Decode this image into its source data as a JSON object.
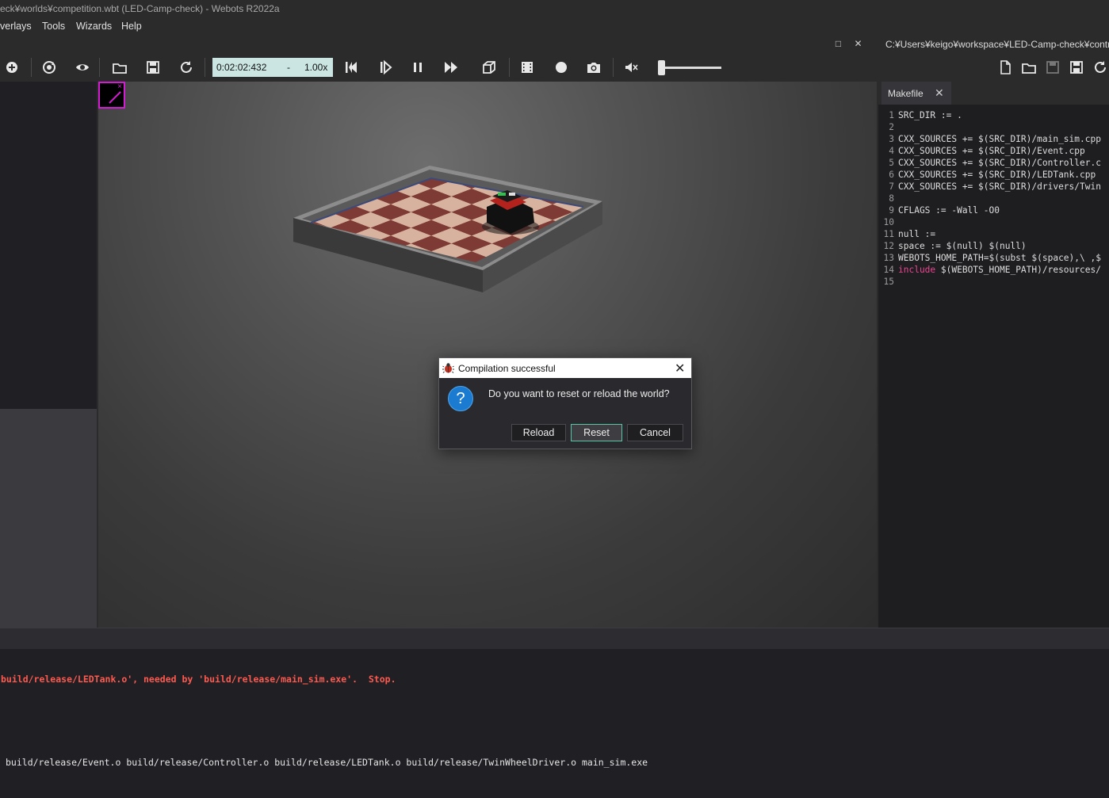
{
  "window": {
    "title": "eck¥worlds¥competition.wbt (LED-Camp-check) - Webots R2022a"
  },
  "menu": {
    "items": [
      {
        "label": "verlays"
      },
      {
        "label": "Tools"
      },
      {
        "label": "Wizards"
      },
      {
        "label": "Help"
      }
    ]
  },
  "panelbar": {
    "restore_symbol": "□",
    "close_symbol": "✕",
    "editor_path": "C:¥Users¥keigo¥workspace¥LED-Camp-check¥controll"
  },
  "toolbar": {
    "icons": [
      "add-node-icon",
      "reset-view-icon",
      "view-icon",
      "open-world-icon",
      "save-world-icon",
      "reload-world-icon",
      "reset-simulation-icon",
      "step-icon",
      "pause-icon",
      "fast-forward-icon",
      "view-3d-icon",
      "movie-icon",
      "record-icon",
      "screenshot-icon",
      "mute-icon"
    ],
    "simulation_time": "0:02:02:432",
    "speed_separator": "-",
    "speed": "1.00x",
    "volume_level": 0.05
  },
  "editor": {
    "tab_label": "Makefile",
    "tab_close": "✕",
    "lines": [
      {
        "n": "1",
        "text": "SRC_DIR := ."
      },
      {
        "n": "2",
        "text": ""
      },
      {
        "n": "3",
        "text": "CXX_SOURCES += $(SRC_DIR)/main_sim.cpp"
      },
      {
        "n": "4",
        "text": "CXX_SOURCES += $(SRC_DIR)/Event.cpp"
      },
      {
        "n": "5",
        "text": "CXX_SOURCES += $(SRC_DIR)/Controller.c"
      },
      {
        "n": "6",
        "text": "CXX_SOURCES += $(SRC_DIR)/LEDTank.cpp"
      },
      {
        "n": "7",
        "text": "CXX_SOURCES += $(SRC_DIR)/drivers/Twin"
      },
      {
        "n": "8",
        "text": ""
      },
      {
        "n": "9",
        "text": "CFLAGS := -Wall -O0"
      },
      {
        "n": "10",
        "text": ""
      },
      {
        "n": "11",
        "text": "null :="
      },
      {
        "n": "12",
        "text": "space := $(null) $(null)"
      },
      {
        "n": "13",
        "text": "WEBOTS_HOME_PATH=$(subst $(space),\\ ,$"
      },
      {
        "n": "14",
        "keyword": "include",
        "text": " $(WEBOTS_HOME_PATH)/resources/"
      },
      {
        "n": "15",
        "text": ""
      }
    ],
    "keyword_color": "#e8468f"
  },
  "console": {
    "error_line": "build/release/LEDTank.o', needed by 'build/release/main_sim.exe'.  Stop.",
    "output_line": "build/release/Event.o build/release/Controller.o build/release/LEDTank.o build/release/TwinWheelDriver.o main_sim.exe",
    "error_color": "#ff5a4f"
  },
  "dialog": {
    "title": "Compilation successful",
    "close_symbol": "✕",
    "icon_glyph": "?",
    "message": "Do you want to reset or reload the world?",
    "buttons": {
      "reload": "Reload",
      "reset": "Reset",
      "cancel": "Cancel"
    }
  },
  "overlay": {
    "display_close": "×"
  }
}
